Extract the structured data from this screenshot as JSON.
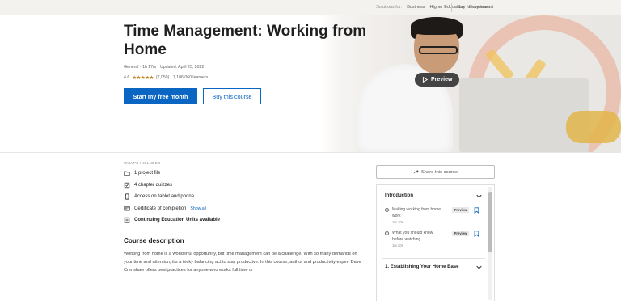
{
  "topnav": {
    "solutions_for": "Solutions for:",
    "business": "Business",
    "higher_education": "Higher Education",
    "government": "Government",
    "buy_for_team": "Buy for my team"
  },
  "course": {
    "title": "Time Management: Working from Home",
    "meta": "General · 1h 17m · Updated: April 25, 2022",
    "rating_value": "4.6",
    "rating_count_text": "(7,050) · 1,106,060 learners",
    "primary_cta": "Start my free month",
    "secondary_cta": "Buy this course",
    "preview_label": "Preview"
  },
  "included": {
    "label": "WHAT'S INCLUDED",
    "items": [
      {
        "icon": "folder-icon",
        "text": "1 project file"
      },
      {
        "icon": "quiz-icon",
        "text": "4 chapter quizzes"
      },
      {
        "icon": "mobile-icon",
        "text": "Access on tablet and phone"
      },
      {
        "icon": "certificate-icon",
        "text": "Certificate of completion",
        "link": "Show all"
      },
      {
        "icon": "ceu-icon",
        "text": "Continuing Education Units available"
      }
    ]
  },
  "description": {
    "title": "Course description",
    "text": "Working from home is a wonderful opportunity, but time management can be a challenge. With so many demands on your time and attention, it's a tricky balancing act to stay productive. In this course, author and productivity expert Dave Crenshaw offers best practices for anyone who works full time or"
  },
  "share": {
    "label": "Share this course"
  },
  "toc": {
    "sections": [
      {
        "title": "Introduction",
        "lessons": [
          {
            "title": "Making working from home work",
            "duration": "1m 10s",
            "badge": "Preview"
          },
          {
            "title": "What you should know before watching",
            "duration": "1m 20s",
            "badge": "Preview"
          }
        ]
      },
      {
        "title": "1. Establishing Your Home Base",
        "lessons": []
      }
    ]
  },
  "colors": {
    "accent": "#0a66c2",
    "star": "#c37d16"
  }
}
